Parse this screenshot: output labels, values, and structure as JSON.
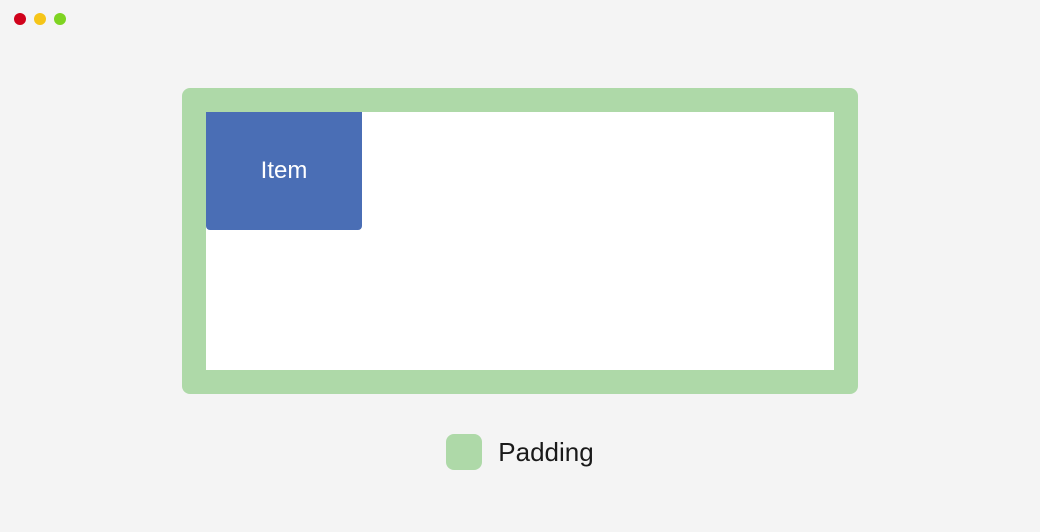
{
  "diagram": {
    "item_label": "Item",
    "colors": {
      "padding": "#aed9a8",
      "item": "#4a6eb5",
      "content": "#ffffff"
    }
  },
  "legend": {
    "padding_label": "Padding"
  }
}
